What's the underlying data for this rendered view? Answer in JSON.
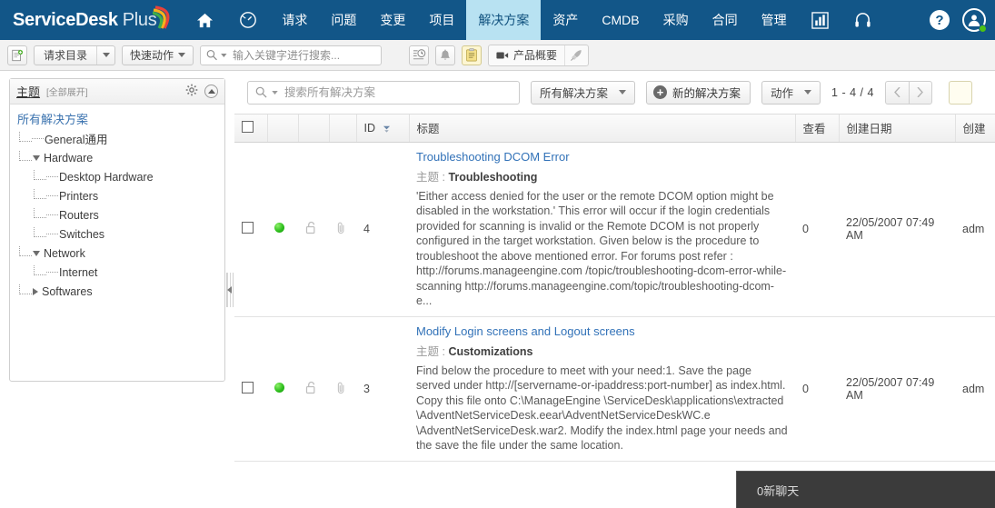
{
  "header": {
    "brand_bold": "ServiceDesk",
    "brand_light": "Plus",
    "nav": [
      {
        "label": "首页",
        "icon": "home-icon",
        "type": "icon"
      },
      {
        "label": "仪表盘",
        "icon": "dashboard-icon",
        "type": "icon"
      },
      {
        "label": "请求",
        "type": "text"
      },
      {
        "label": "问题",
        "type": "text"
      },
      {
        "label": "变更",
        "type": "text"
      },
      {
        "label": "项目",
        "type": "text"
      },
      {
        "label": "解决方案",
        "type": "text",
        "active": true
      },
      {
        "label": "资产",
        "type": "text"
      },
      {
        "label": "CMDB",
        "type": "text"
      },
      {
        "label": "采购",
        "type": "text"
      },
      {
        "label": "合同",
        "type": "text"
      },
      {
        "label": "管理",
        "type": "text"
      },
      {
        "label": "报表",
        "icon": "bar-chart-icon",
        "type": "icon"
      },
      {
        "label": "支持",
        "icon": "headset-icon",
        "type": "icon"
      }
    ],
    "help_label": "?",
    "avatar_name": "user-avatar",
    "accent_bg": "#125688",
    "active_tab_bg": "#b8e2f2"
  },
  "toolbar": {
    "new_request_icon": "new-request-icon",
    "request_catalog_label": "请求目录",
    "quick_action_label": "快速动作",
    "search_placeholder": "输入关键字进行搜索...",
    "search_value": "",
    "history_icon": "history-icon",
    "bell_icon": "bell-icon",
    "notes_icon": "notes-icon",
    "product_overview_label": "产品概要",
    "product_overview_icon": "video-camera-icon",
    "rocket_icon": "rocket-icon"
  },
  "sidebar": {
    "title": "主题",
    "expand_all": "[全部展开]",
    "gear_icon": "gear-icon",
    "collapse_icon": "chevron-up-icon",
    "root_label": "所有解决方案",
    "nodes": [
      {
        "label": "General通用",
        "level": 1,
        "toggle": "none"
      },
      {
        "label": "Hardware",
        "level": 1,
        "toggle": "down"
      },
      {
        "label": "Desktop Hardware",
        "level": 2,
        "toggle": "none"
      },
      {
        "label": "Printers",
        "level": 2,
        "toggle": "none"
      },
      {
        "label": "Routers",
        "level": 2,
        "toggle": "none"
      },
      {
        "label": "Switches",
        "level": 2,
        "toggle": "none"
      },
      {
        "label": "Network",
        "level": 1,
        "toggle": "down"
      },
      {
        "label": "Internet",
        "level": 2,
        "toggle": "none"
      },
      {
        "label": "Softwares",
        "level": 1,
        "toggle": "right"
      }
    ],
    "splitter_icon": "collapse-left-icon"
  },
  "main": {
    "search_placeholder": "搜索所有解决方案",
    "search_value": "",
    "filter_label": "所有解决方案",
    "new_solution_label": "新的解决方案",
    "actions_label": "动作",
    "pagination_label": "1 - 4 / 4",
    "prev_icon": "chevron-left-icon",
    "next_icon": "chevron-right-icon",
    "columns": [
      {
        "key": "checkbox",
        "label": ""
      },
      {
        "key": "status",
        "label": ""
      },
      {
        "key": "lock",
        "label": ""
      },
      {
        "key": "attach",
        "label": ""
      },
      {
        "key": "id",
        "label": "ID",
        "sortable": true
      },
      {
        "key": "title",
        "label": "标题"
      },
      {
        "key": "views",
        "label": "查看"
      },
      {
        "key": "created_date",
        "label": "创建日期"
      },
      {
        "key": "created_by",
        "label": "创建"
      }
    ],
    "sort_icon": "sort-desc-icon",
    "rows": [
      {
        "status_icon": "green-status-dot",
        "lock_icon": "unlock-icon",
        "attach_icon": "paperclip-icon",
        "id": "4",
        "title": "Troubleshooting DCOM Error",
        "topic_label": "主题",
        "topic_value": "Troubleshooting",
        "body": "'Either access denied for the user or the remote DCOM option might be disabled in the workstation.' This error will occur if the login credentials provided for scanning is invalid or the Remote DCOM is not properly configured in the target workstation. Given below is the procedure to troubleshoot the above mentioned error. For forums post refer : http://forums.manageengine.com /topic/troubleshooting-dcom-error-while-scanning http://forums.manageengine.com/topic/troubleshooting-dcom-e...",
        "views": "0",
        "created_date": "22/05/2007 07:49 AM",
        "created_by": "adm"
      },
      {
        "status_icon": "green-status-dot",
        "lock_icon": "unlock-icon",
        "attach_icon": "paperclip-icon",
        "id": "3",
        "title": "Modify Login screens and Logout screens",
        "topic_label": "主题",
        "topic_value": "Customizations",
        "body": "Find below the procedure to meet with your need:1. Save the page served under http://[servername-or-ipaddress:port-number] as index.html. Copy this file onto C:\\ManageEngine \\ServiceDesk\\applications\\extracted \\AdventNetServiceDesk.eear\\AdventNetServiceDeskWC.e \\AdventNetServiceDesk.war2. Modify the index.html page your needs and the save the file under the same location.",
        "views": "0",
        "created_date": "22/05/2007 07:49 AM",
        "created_by": "adm"
      }
    ]
  },
  "chat": {
    "label": "0新聊天"
  }
}
